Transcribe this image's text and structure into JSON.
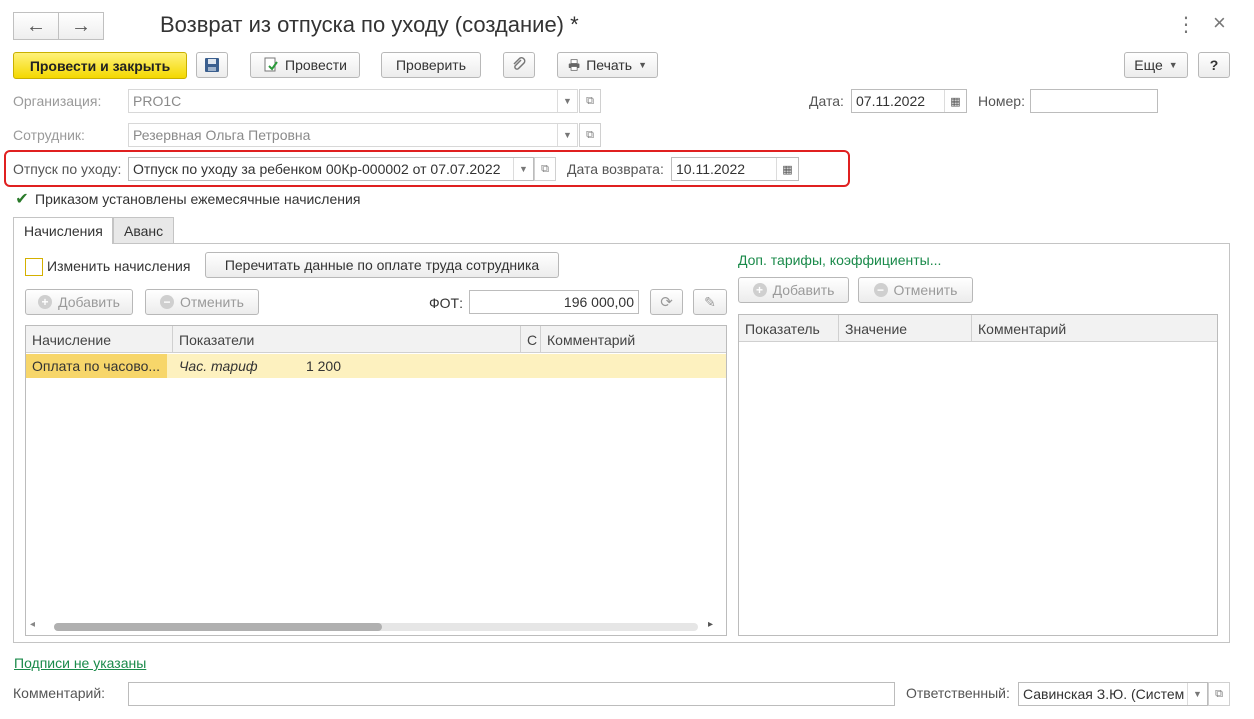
{
  "header": {
    "title": "Возврат из отпуска по уходу (создание) *",
    "back_icon": "←",
    "forward_icon": "→",
    "more_icon": "⋮",
    "close_icon": "×"
  },
  "toolbar": {
    "post_close_label": "Провести и закрыть",
    "post_label": "Провести",
    "check_label": "Проверить",
    "print_label": "Печать",
    "more_label": "Еще",
    "help_label": "?"
  },
  "form": {
    "organization_label": "Организация:",
    "organization_value": "PRO1C",
    "employee_label": "Сотрудник:",
    "employee_value": "Резервная Ольга Петровна",
    "date_label": "Дата:",
    "date_value": "07.11.2022",
    "number_label": "Номер:",
    "number_value": "",
    "leave_label": "Отпуск по уходу:",
    "leave_value": "Отпуск по уходу за ребенком 00Кр-000002 от 07.07.2022",
    "return_date_label": "Дата возврата:",
    "return_date_value": "10.11.2022",
    "monthly_accruals_label": "Приказом установлены ежемесячные начисления",
    "monthly_accruals_checked": true
  },
  "tabs": [
    {
      "label": "Начисления",
      "active": true
    },
    {
      "label": "Аванс",
      "active": false
    }
  ],
  "accruals": {
    "change_label": "Изменить начисления",
    "change_checked": false,
    "reread_label": "Перечитать данные по оплате труда сотрудника",
    "add_label": "Добавить",
    "cancel_label": "Отменить",
    "fot_label": "ФОТ:",
    "fot_value": "196 000,00",
    "columns": [
      "Начисление",
      "Показатели",
      "С",
      "Комментарий"
    ],
    "rows": [
      {
        "accrual": "Оплата по часово...",
        "indicator": "Час. тариф",
        "value": "1 200"
      }
    ]
  },
  "tariffs": {
    "link_label": "Доп. тарифы, коэффициенты...",
    "add_label": "Добавить",
    "cancel_label": "Отменить",
    "columns": [
      "Показатель",
      "Значение",
      "Комментарий"
    ]
  },
  "footer": {
    "signatures_link": "Подписи не указаны",
    "comment_label": "Комментарий:",
    "comment_value": "",
    "responsible_label": "Ответственный:",
    "responsible_value": "Савинская З.Ю. (Систем"
  }
}
